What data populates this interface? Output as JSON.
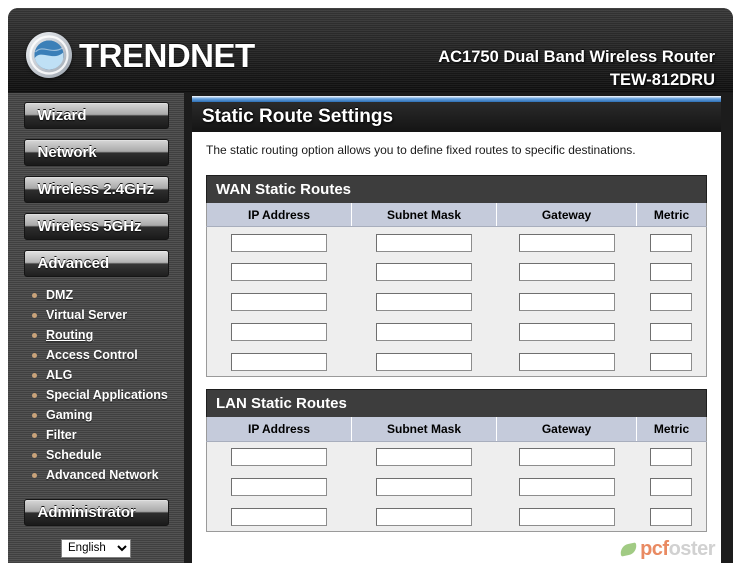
{
  "header": {
    "logo_text": "TRENDNET",
    "logo_icon": "trendnet-wave-logo",
    "product_name": "AC1750 Dual Band Wireless Router",
    "model": "TEW-812DRU"
  },
  "sidebar": {
    "nav_buttons": [
      {
        "label": "Wizard",
        "active": false
      },
      {
        "label": "Network",
        "active": false
      },
      {
        "label": "Wireless 2.4GHz",
        "active": false
      },
      {
        "label": "Wireless 5GHz",
        "active": false
      },
      {
        "label": "Advanced",
        "active": true
      }
    ],
    "submenu": [
      {
        "label": "DMZ",
        "active": false
      },
      {
        "label": "Virtual Server",
        "active": false
      },
      {
        "label": "Routing",
        "active": true
      },
      {
        "label": "Access Control",
        "active": false
      },
      {
        "label": "ALG",
        "active": false
      },
      {
        "label": "Special Applications",
        "active": false
      },
      {
        "label": "Gaming",
        "active": false
      },
      {
        "label": "Filter",
        "active": false
      },
      {
        "label": "Schedule",
        "active": false
      },
      {
        "label": "Advanced Network",
        "active": false
      }
    ],
    "admin_button_label": "Administrator",
    "language": {
      "selected": "English",
      "options": [
        "English"
      ]
    }
  },
  "main": {
    "page_title": "Static Route Settings",
    "description": "The static routing option allows you to define fixed routes to specific destinations.",
    "columns": [
      "IP Address",
      "Subnet Mask",
      "Gateway",
      "Metric"
    ],
    "sections": [
      {
        "title": "WAN Static Routes",
        "rows": [
          {
            "ip": "",
            "mask": "",
            "gateway": "",
            "metric": ""
          },
          {
            "ip": "",
            "mask": "",
            "gateway": "",
            "metric": ""
          },
          {
            "ip": "",
            "mask": "",
            "gateway": "",
            "metric": ""
          },
          {
            "ip": "",
            "mask": "",
            "gateway": "",
            "metric": ""
          },
          {
            "ip": "",
            "mask": "",
            "gateway": "",
            "metric": ""
          }
        ]
      },
      {
        "title": "LAN Static Routes",
        "rows": [
          {
            "ip": "",
            "mask": "",
            "gateway": "",
            "metric": ""
          },
          {
            "ip": "",
            "mask": "",
            "gateway": "",
            "metric": ""
          },
          {
            "ip": "",
            "mask": "",
            "gateway": "",
            "metric": ""
          }
        ]
      }
    ]
  },
  "watermark": {
    "text_primary": "pcf",
    "text_secondary": "oster",
    "icon": "leaf-icon"
  },
  "colors": {
    "accent_blue": "#2d6fb5",
    "sidebar_bg": "#4a4a4a",
    "section_header_bg": "#3d3d3d",
    "column_header_bg": "#c5cbdb",
    "bullet": "#c9a37a"
  }
}
